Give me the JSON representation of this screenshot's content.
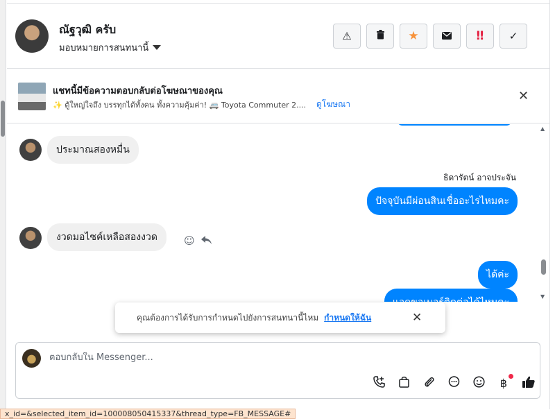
{
  "header": {
    "contact_name": "ณัฐวุฒิ ครับ",
    "assign_label": "มอบหมายการสนทนานี้",
    "actions": [
      {
        "name": "report-button",
        "icon": "warning-icon",
        "glyph": "⚠"
      },
      {
        "name": "delete-button",
        "icon": "trash-icon",
        "glyph": "🗑"
      },
      {
        "name": "star-button",
        "icon": "star-icon",
        "glyph": "★"
      },
      {
        "name": "mail-button",
        "icon": "mail-icon",
        "glyph": "✉"
      },
      {
        "name": "urgent-button",
        "icon": "double-exclamation-icon",
        "glyph": "‼"
      },
      {
        "name": "done-button",
        "icon": "check-icon",
        "glyph": "✓"
      }
    ]
  },
  "ad": {
    "title": "แชทนี้มีข้อความตอบกลับต่อโฆษณาของคุณ",
    "subtitle": "✨ ตู้ใหญ่ใจถึง บรรทุกได้ทั้งคน ทั้งความคุ้มค่า! 🚐 Toyota Commuter 2....",
    "link": "ดูโฆษณา"
  },
  "messages": {
    "m1": "ประมาณสองหมื่น",
    "sender": "ธิดารัตน์ อาจประจัน",
    "m2": "ปัจจุบันมีผ่อนสินเชื่ออะไรไหมคะ",
    "m3": "งวดมอไซค์เหลือสองงวด",
    "m4": "ได้ค่ะ",
    "m5": "แอดขอเบอร์ติดต่อได้ไหมคะ"
  },
  "toast": {
    "text": "คุณต้องการได้รับการกำหนดไปยังการสนทนานี้ไหม",
    "link": "กำหนดให้ฉัน"
  },
  "composer": {
    "placeholder": "ตอบกลับใน Messenger..."
  },
  "status_url": "x_id=&selected_item_id=100008050415337&thread_type=FB_MESSAGE#",
  "colors": {
    "accent": "#0084ff",
    "link": "#1877f2",
    "star": "#f7923a",
    "urgent": "#e41e3f",
    "badge_dot": "#f02849"
  }
}
